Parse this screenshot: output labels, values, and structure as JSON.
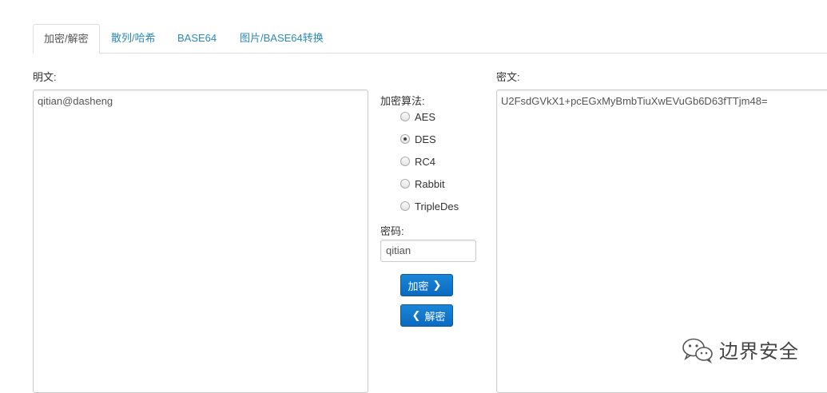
{
  "tabs": [
    {
      "label": "加密/解密"
    },
    {
      "label": "散列/哈希"
    },
    {
      "label": "BASE64"
    },
    {
      "label": "图片/BASE64转换"
    }
  ],
  "plaintext": {
    "label": "明文:",
    "value": "qitian@dasheng"
  },
  "ciphertext": {
    "label": "密文:",
    "value": "U2FsdGVkX1+pcEGxMyBmbTiuXwEVuGb6D63fTTjm48="
  },
  "algorithm": {
    "label": "加密算法:",
    "options": [
      "AES",
      "DES",
      "RC4",
      "Rabbit",
      "TripleDes"
    ],
    "selected": "DES"
  },
  "password": {
    "label": "密码:",
    "value": "qitian"
  },
  "buttons": {
    "encrypt": "加密",
    "decrypt": "解密"
  },
  "watermark": {
    "text": "边界安全"
  }
}
